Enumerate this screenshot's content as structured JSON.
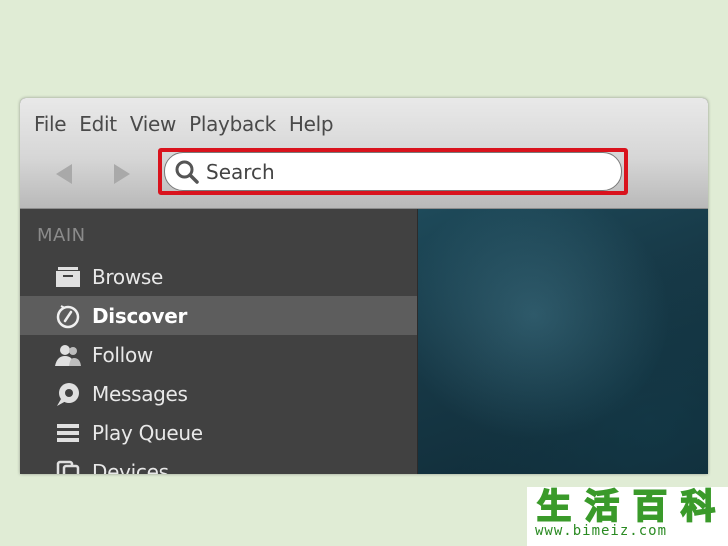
{
  "menu": [
    "File",
    "Edit",
    "View",
    "Playback",
    "Help"
  ],
  "nav": {
    "back_icon": "triangle-left-icon",
    "forward_icon": "triangle-right-icon"
  },
  "search": {
    "placeholder": "Search",
    "highlight_color": "#d9131d"
  },
  "sidebar": {
    "section": "MAIN",
    "items": [
      {
        "label": "Browse",
        "icon": "browse-icon",
        "active": false
      },
      {
        "label": "Discover",
        "icon": "discover-icon",
        "active": true
      },
      {
        "label": "Follow",
        "icon": "follow-icon",
        "active": false
      },
      {
        "label": "Messages",
        "icon": "messages-icon",
        "active": false
      },
      {
        "label": "Play Queue",
        "icon": "play-queue-icon",
        "active": false
      },
      {
        "label": "Devices",
        "icon": "devices-icon",
        "active": false
      }
    ]
  },
  "watermark": {
    "chars": [
      "生",
      "活",
      "百",
      "科"
    ],
    "url": "www.bimeiz.com"
  },
  "colors": {
    "background": "#e0ecd5",
    "sidebar": "#414141",
    "active_item": "#5d5d5d",
    "watermark": "#3a9a2a"
  }
}
